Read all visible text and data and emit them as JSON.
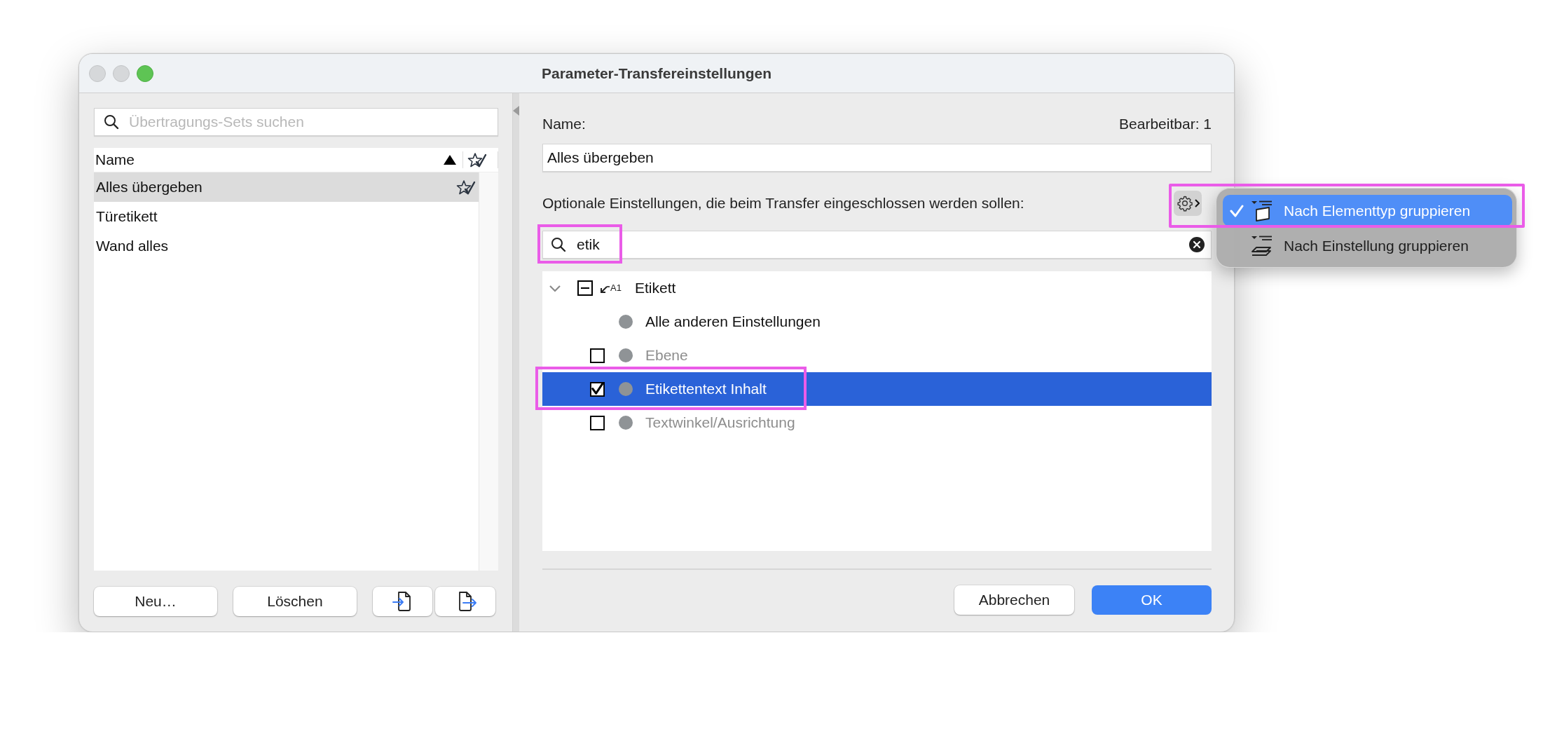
{
  "window": {
    "title": "Parameter-Transfereinstellungen"
  },
  "sets": {
    "search": {
      "placeholder": "Übertragungs-Sets suchen"
    },
    "header": {
      "label": "Name",
      "ascending": true
    },
    "rows": [
      {
        "name": "Alles übergeben",
        "selected": true,
        "favorite": true
      },
      {
        "name": "Türetikett",
        "selected": false,
        "favorite": false
      },
      {
        "name": "Wand alles",
        "selected": false,
        "favorite": false
      }
    ],
    "buttons": [
      {
        "kind": "text",
        "label": "Neu…"
      },
      {
        "kind": "text",
        "label": "Löschen"
      },
      {
        "kind": "import"
      },
      {
        "kind": "export"
      }
    ]
  },
  "details": {
    "name_label": "Name:",
    "editable": "Bearbeitbar: 1",
    "name_field": {
      "value": "Alles übergeben"
    },
    "options_label": "Optionale Einstellungen, die beim Transfer eingeschlossen werden sollen:",
    "filter": {
      "value": "etik",
      "highlighted": true
    },
    "tree": [
      {
        "label": "Etikett",
        "icon_label": "A1",
        "expanded": true,
        "partial": true,
        "children": [
          {
            "kind": "fixed",
            "label": "Alle anderen Einstellungen",
            "selected": false,
            "highlighted": false
          },
          {
            "kind": "option",
            "label": "Ebene",
            "checked": false,
            "selected": false,
            "highlighted": false
          },
          {
            "kind": "option",
            "label": "Etikettentext Inhalt",
            "checked": true,
            "selected": true,
            "highlighted": true
          },
          {
            "kind": "option",
            "label": "Textwinkel/Ausrichtung",
            "checked": false,
            "selected": false,
            "highlighted": false
          }
        ]
      }
    ],
    "buttons": [
      {
        "kind": "secondary",
        "label": "Abbrechen"
      },
      {
        "kind": "primary",
        "label": "OK"
      }
    ]
  },
  "menu": {
    "highlighted": true,
    "items": [
      {
        "kind": "element-type",
        "label": "Nach Elementtyp gruppieren",
        "selected": true
      },
      {
        "kind": "setting",
        "label": "Nach Einstellung gruppieren",
        "selected": false
      }
    ]
  }
}
